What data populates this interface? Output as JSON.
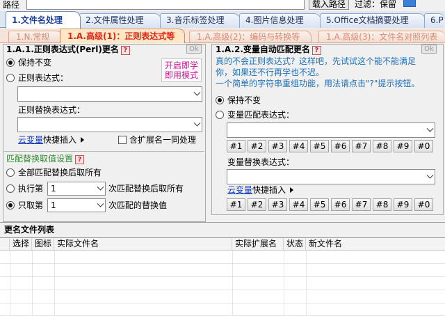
{
  "pathbar": {
    "path_label": "路径",
    "load_button": "载入路径",
    "filter_label": "过滤：保留"
  },
  "main_tabs": [
    {
      "label": "1.文件名处理"
    },
    {
      "label": "2.文件属性处理"
    },
    {
      "label": "3.音乐标签处理"
    },
    {
      "label": "4.图片信息处理"
    },
    {
      "label": "5.Office文档摘要处理"
    },
    {
      "label": "6.P"
    }
  ],
  "sub_tabs": [
    {
      "label": "1.N.常规"
    },
    {
      "label": "1.A.高级(1)：正则表达式等"
    },
    {
      "label": "1.A.高级(2)：编码与转换等"
    },
    {
      "label": "1.A.高级(3)：文件名对照列表"
    }
  ],
  "left_panel": {
    "title": "1.A.1.正则表达式(Perl)更名",
    "help": "?",
    "ok": "Ok",
    "instant_mode": "开启即学\n即用模式",
    "keep_unchanged": "保持不变",
    "regex_label": "正则表达式：",
    "regex_value": "",
    "replace_label": "正则替换表达式：",
    "replace_value": "",
    "cloud_var": "云变量",
    "quick_insert": "快捷插入",
    "include_ext": "含扩展名一同处理",
    "match_section": {
      "title": "匹配替换取值设置",
      "help": "?",
      "all": "全部匹配替换后取所有",
      "exec_nth": "执行第",
      "exec_value": "1",
      "exec_suffix": "次匹配替换后取所有",
      "only_nth": "只取第",
      "only_value": "1",
      "only_suffix": "次匹配的替换值"
    }
  },
  "right_panel": {
    "title": "1.A.2.变量自动匹配更名",
    "help": "?",
    "ok": "Ok",
    "desc_line1": "真的不会正则表达式？这样吧，先试试这个能不能满足",
    "desc_line2": "你，如果还不行再学也不迟。",
    "desc_line3": "一个简单的字符串重组功能，用法请点击\"?\"提示按钮。",
    "keep_unchanged": "保持不变",
    "var_match_label": "变量匹配表达式：",
    "var_match_value": "",
    "num_buttons_top": [
      "#1",
      "#2",
      "#3",
      "#4",
      "#5",
      "#6",
      "#7",
      "#8",
      "#9",
      "#0"
    ],
    "var_replace_label": "变量替换表达式：",
    "var_replace_value": "",
    "cloud_var": "云变量",
    "quick_insert": "快捷插入",
    "num_buttons_bottom": [
      "#1",
      "#2",
      "#3",
      "#4",
      "#5",
      "#6",
      "#7",
      "#8",
      "#9",
      "#0"
    ]
  },
  "file_list": {
    "title": "更名文件列表",
    "columns": [
      "选择",
      "图标",
      "实际文件名",
      "实际扩展名",
      "状态",
      "新文件名"
    ]
  },
  "colors": {
    "active_main_tab_text": "#1a3fa0",
    "active_sub_tab_text": "#e0261b",
    "instant_mode_text": "#d0169c",
    "desc_text": "#1e6fb8",
    "section_green": "#2e8b2e"
  }
}
